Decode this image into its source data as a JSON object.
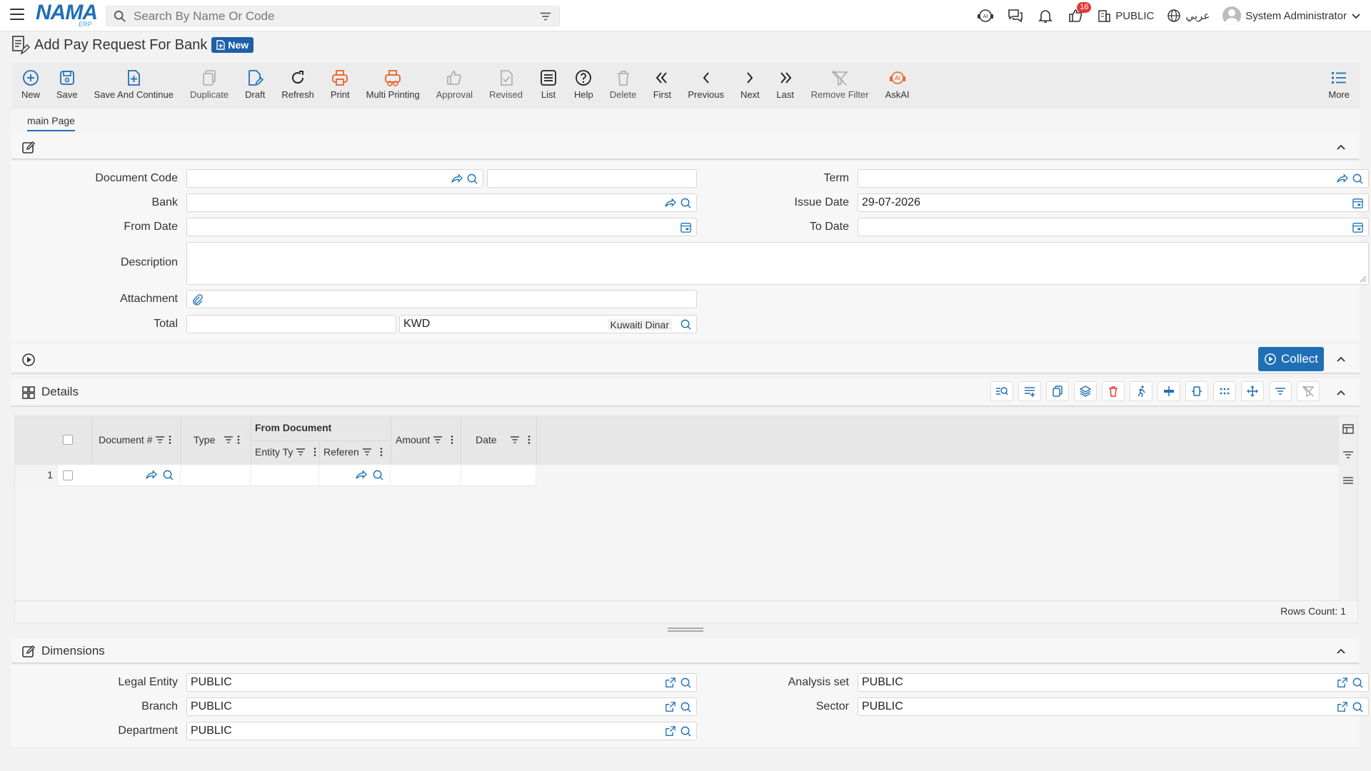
{
  "topbar": {
    "search_placeholder": "Search By Name Or Code",
    "logo_text": "NAMA",
    "logo_sub": "ERP",
    "notifications_count": "16",
    "branch": "PUBLIC",
    "language": "عربي",
    "user": "System Administrator"
  },
  "page": {
    "title": "Add Pay Request For Bank",
    "status_badge": "New"
  },
  "toolbar": [
    {
      "label": "New",
      "icon": "plus-circle-icon"
    },
    {
      "label": "Save",
      "icon": "save-icon"
    },
    {
      "label": "Save And Continue",
      "icon": "save-continue-icon"
    },
    {
      "label": "Duplicate",
      "icon": "duplicate-icon"
    },
    {
      "label": "Draft",
      "icon": "draft-icon"
    },
    {
      "label": "Refresh",
      "icon": "refresh-icon"
    },
    {
      "label": "Print",
      "icon": "print-icon"
    },
    {
      "label": "Multi Printing",
      "icon": "multi-print-icon"
    },
    {
      "label": "Approval",
      "icon": "approval-icon"
    },
    {
      "label": "Revised",
      "icon": "revised-icon"
    },
    {
      "label": "List",
      "icon": "list-icon"
    },
    {
      "label": "Help",
      "icon": "help-icon"
    },
    {
      "label": "Delete",
      "icon": "delete-icon"
    },
    {
      "label": "First",
      "icon": "first-icon"
    },
    {
      "label": "Previous",
      "icon": "previous-icon"
    },
    {
      "label": "Next",
      "icon": "next-icon"
    },
    {
      "label": "Last",
      "icon": "last-icon"
    },
    {
      "label": "Remove Filter",
      "icon": "remove-filter-icon"
    },
    {
      "label": "AskAI",
      "icon": "ask-ai-icon"
    }
  ],
  "more_label": "More",
  "tabs": [
    {
      "label": "main Page"
    }
  ],
  "form": {
    "document_code_label": "Document Code",
    "document_code_value": "",
    "document_code_name": "",
    "term_label": "Term",
    "term_value": "",
    "bank_label": "Bank",
    "bank_value": "",
    "issue_date_label": "Issue Date",
    "issue_date_value": "29-07-2026",
    "from_date_label": "From Date",
    "from_date_value": "",
    "to_date_label": "To Date",
    "to_date_value": "",
    "description_label": "Description",
    "description_value": "",
    "attachment_label": "Attachment",
    "total_label": "Total",
    "total_value": "",
    "currency_code": "KWD",
    "currency_name": "Kuwaiti Dinar"
  },
  "collect_button": "Collect",
  "details": {
    "title": "Details",
    "group_header": "From Document",
    "columns": {
      "document_no": "Document #",
      "type": "Type",
      "entity_type": "Entity Ty",
      "reference": "Referen",
      "amount": "Amount",
      "date": "Date"
    },
    "rows": [
      {
        "row_no": "1"
      }
    ],
    "rows_count": "Rows Count: 1"
  },
  "dimensions": {
    "title": "Dimensions",
    "legal_entity_label": "Legal Entity",
    "legal_entity_value": "PUBLIC",
    "analysis_set_label": "Analysis set",
    "analysis_set_value": "PUBLIC",
    "branch_label": "Branch",
    "branch_value": "PUBLIC",
    "sector_label": "Sector",
    "sector_value": "PUBLIC",
    "department_label": "Department",
    "department_value": "PUBLIC"
  },
  "colors": {
    "accent": "#1f6fb5",
    "badge_red": "#e53935",
    "print_orange": "#e8632a"
  }
}
